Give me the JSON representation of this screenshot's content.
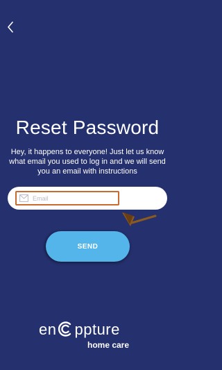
{
  "header": {
    "back_icon": "chevron-left-icon"
  },
  "main": {
    "title": "Reset Password",
    "instructions": "Hey, it happens to everyone! Just let us know what email you used to log in and we will send you an email with instructions",
    "email_field": {
      "icon": "mail-icon",
      "placeholder": "Email",
      "value": ""
    },
    "send_label": "SEND"
  },
  "logo": {
    "prefix": "en",
    "suffix": "ppture",
    "tagline": "home care"
  },
  "colors": {
    "background": "#25306e",
    "button": "#54b5ea",
    "annotation": "#c96a2e",
    "text": "#ffffff"
  }
}
